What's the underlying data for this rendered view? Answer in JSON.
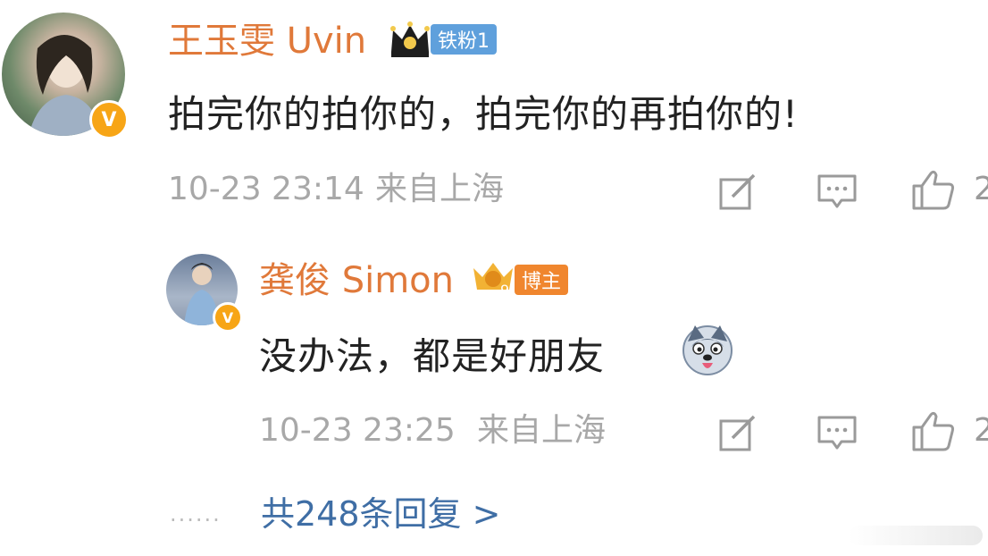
{
  "comment": {
    "user_name": "王玉雯 Uvin",
    "fan_badge": "铁粉1",
    "verified_mark": "V",
    "text": "拍完你的拍你的，拍完你的再拍你的!",
    "timestamp": "10-23 23:14",
    "location": "来自上海",
    "like_count_partial": "2"
  },
  "reply": {
    "user_name": "龚俊 Simon",
    "role_badge": "博主",
    "verified_mark": "V",
    "text": "没办法，都是好朋友",
    "emoji": "husky-emoji",
    "timestamp": "10-23 23:25",
    "location": "来自上海",
    "like_count_partial": "2"
  },
  "more_replies": {
    "dots": "......",
    "label": "共248条回复 >"
  },
  "colors": {
    "name": "#e0793a",
    "text": "#222222",
    "meta": "#a8a8a8",
    "link": "#3f6ea5",
    "verified": "#f7a516",
    "fan_badge": "#5fa0dc",
    "role_badge": "#f0862e"
  }
}
